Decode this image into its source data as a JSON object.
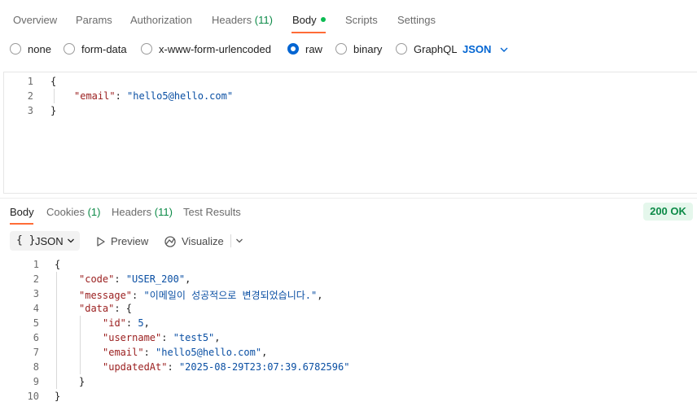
{
  "request_tabs": {
    "overview": "Overview",
    "params": "Params",
    "authorization": "Authorization",
    "headers": "Headers",
    "headers_count": "(11)",
    "body": "Body",
    "scripts": "Scripts",
    "settings": "Settings"
  },
  "body_types": {
    "none": "none",
    "form_data": "form-data",
    "urlencoded": "x-www-form-urlencoded",
    "raw": "raw",
    "binary": "binary",
    "graphql": "GraphQL",
    "language": "JSON",
    "selected": "raw"
  },
  "request_body": {
    "line_numbers": [
      "1",
      "2",
      "3"
    ],
    "open_brace": "{",
    "email_key": "\"email\"",
    "email_value": "\"hello5@hello.com\"",
    "close_brace": "}"
  },
  "response_tabs": {
    "body": "Body",
    "cookies": "Cookies",
    "cookies_count": "(1)",
    "headers": "Headers",
    "headers_count": "(11)",
    "test_results": "Test Results"
  },
  "status": {
    "code": "200 OK",
    "color": "#0c8a47"
  },
  "response_toolbar": {
    "format_icon": "{ }",
    "format": "JSON",
    "preview": "Preview",
    "visualize": "Visualize"
  },
  "response_body": {
    "line_numbers": [
      "1",
      "2",
      "3",
      "4",
      "5",
      "6",
      "7",
      "8",
      "9",
      "10"
    ],
    "open_brace": "{",
    "code_key": "\"code\"",
    "code_value": "\"USER_200\"",
    "message_key": "\"message\"",
    "message_value": "\"이메일이 성공적으로 변경되었습니다.\"",
    "data_key": "\"data\"",
    "id_key": "\"id\"",
    "id_value": "5",
    "username_key": "\"username\"",
    "username_value": "\"test5\"",
    "email_key": "\"email\"",
    "email_value": "\"hello5@hello.com\"",
    "updated_key": "\"updatedAt\"",
    "updated_value": "\"2025-08-29T23:07:39.6782596\"",
    "inner_close": "}",
    "close_brace": "}"
  },
  "colors": {
    "accent": "#ff6c37",
    "selected_blue": "#0265d2",
    "json_key": "#9a1e1e",
    "json_string": "#0a4fa3"
  }
}
